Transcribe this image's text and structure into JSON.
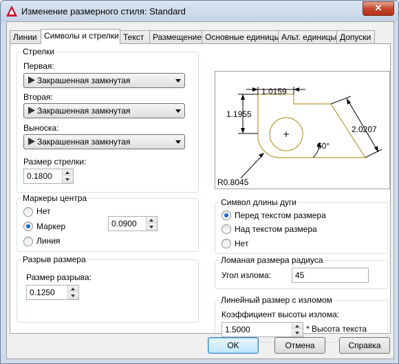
{
  "window": {
    "title": "Изменение размерного стиля: Standard",
    "close_glyph": "✕"
  },
  "tabs": [
    {
      "label": "Линии"
    },
    {
      "label": "Символы и стрелки"
    },
    {
      "label": "Текст"
    },
    {
      "label": "Размещение"
    },
    {
      "label": "Основные единицы"
    },
    {
      "label": "Альт. единицы"
    },
    {
      "label": "Допуски"
    }
  ],
  "active_tab": "Символы и стрелки",
  "arrows": {
    "title": "Стрелки",
    "first_label": "Первая:",
    "first_value": "Закрашенная замкнутая",
    "second_label": "Вторая:",
    "second_value": "Закрашенная замкнутая",
    "leader_label": "Выноска:",
    "leader_value": "Закрашенная замкнутая",
    "size_label": "Размер стрелки:",
    "size_value": "0.1800"
  },
  "center_marks": {
    "title": "Маркеры центра",
    "options": [
      "Нет",
      "Маркер",
      "Линия"
    ],
    "selected": "Маркер",
    "value": "0.0900"
  },
  "dim_break": {
    "title": "Разрыв размера",
    "size_label": "Размер разрыва:",
    "size_value": "0.1250"
  },
  "preview": {
    "dim_top": "1.0159",
    "dim_left": "1.1955",
    "dim_right": "2.0207",
    "angle": "60°",
    "radius": "R0.8045"
  },
  "arc_length": {
    "title": "Символ длины дуги",
    "options": [
      "Перед текстом размера",
      "Над текстом размера",
      "Нет"
    ],
    "selected": "Перед текстом размера"
  },
  "radius_jog": {
    "title": "Ломаная размера радиуса",
    "angle_label": "Угол излома:",
    "angle_value": "45"
  },
  "linear_jog": {
    "title": "Линейный размер с изломом",
    "factor_label": "Коэффициент высоты излома:",
    "factor_value": "1.5000",
    "suffix": "* Высота текста"
  },
  "buttons": {
    "ok": "OK",
    "cancel": "Отмена",
    "help": "Справка"
  },
  "colors": {
    "accent": "#1b6bd1",
    "titlebar": "#cfdbea",
    "preview_outline": "#b89a2e",
    "close": "#c4462c"
  }
}
